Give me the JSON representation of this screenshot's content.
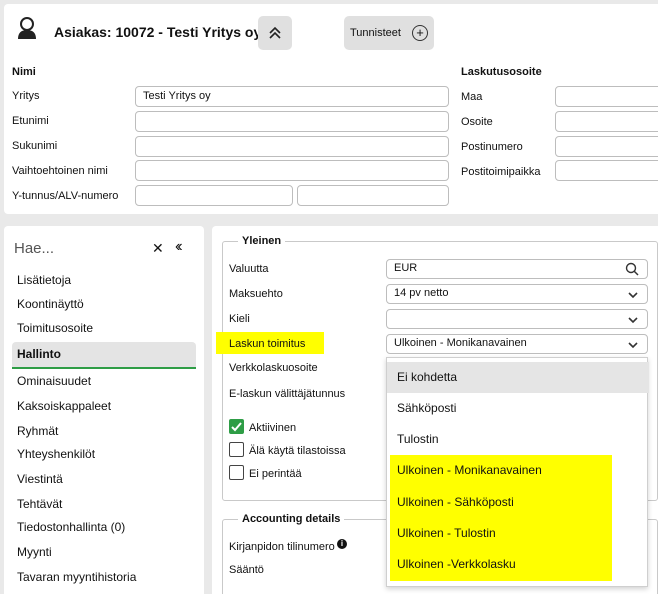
{
  "customer": {
    "title": "Asiakas: 10072 - Testi Yritys oy",
    "tags_label": "Tunnisteet",
    "name_section": "Nimi",
    "billing_section": "Laskutusosoite",
    "fields": {
      "company_label": "Yritys",
      "company_value": "Testi Yritys oy",
      "firstname_label": "Etunimi",
      "lastname_label": "Sukunimi",
      "altname_label": "Vaihtoehtoinen nimi",
      "vat_label": "Y-tunnus/ALV-numero"
    },
    "billing": {
      "country_label": "Maa",
      "address_label": "Osoite",
      "postal_label": "Postinumero",
      "city_label": "Postitoimipaikka"
    }
  },
  "sidebar": {
    "search_placeholder": "Hae...",
    "items": [
      "Lisätietoja",
      "Koontinäyttö",
      "Toimitusosoite",
      "Hallinto",
      "Ominaisuudet",
      "Kaksoiskappaleet",
      "Ryhmät",
      "Yhteyshenkilöt",
      "Viestintä",
      "Tehtävät",
      "Tiedostonhallinta (0)",
      "Myynti",
      "Tavaran myyntihistoria"
    ],
    "active": "Hallinto"
  },
  "general": {
    "legend": "Yleinen",
    "currency_label": "Valuutta",
    "currency_value": "EUR",
    "payment_label": "Maksuehto",
    "payment_value": "14 pv netto",
    "language_label": "Kieli",
    "language_value": "",
    "delivery_label": "Laskun toimitus",
    "delivery_value": "Ulkoinen - Monikanavainen",
    "einvoice_addr_label": "Verkkolaskuosoite",
    "einvoice_op_label": "E-laskun välittäjätunnus",
    "active_label": "Aktiivinen",
    "nostats_label": "Älä käytä tilastoissa",
    "nocollect_label": "Ei perintää"
  },
  "accounting": {
    "legend": "Accounting details",
    "account_label": "Kirjanpidon tilinumero",
    "rule_label": "Sääntö"
  },
  "dropdown": {
    "options": [
      "Ei kohdetta",
      "Sähköposti",
      "Tulostin",
      "Ulkoinen - Monikanavainen",
      "Ulkoinen - Sähköposti",
      "Ulkoinen - Tulostin",
      "Ulkoinen -Verkkolasku"
    ],
    "selected": "Ei kohdetta"
  },
  "colors": {
    "accent_green": "#2e9d46",
    "highlight_yellow": "#ffff00"
  }
}
